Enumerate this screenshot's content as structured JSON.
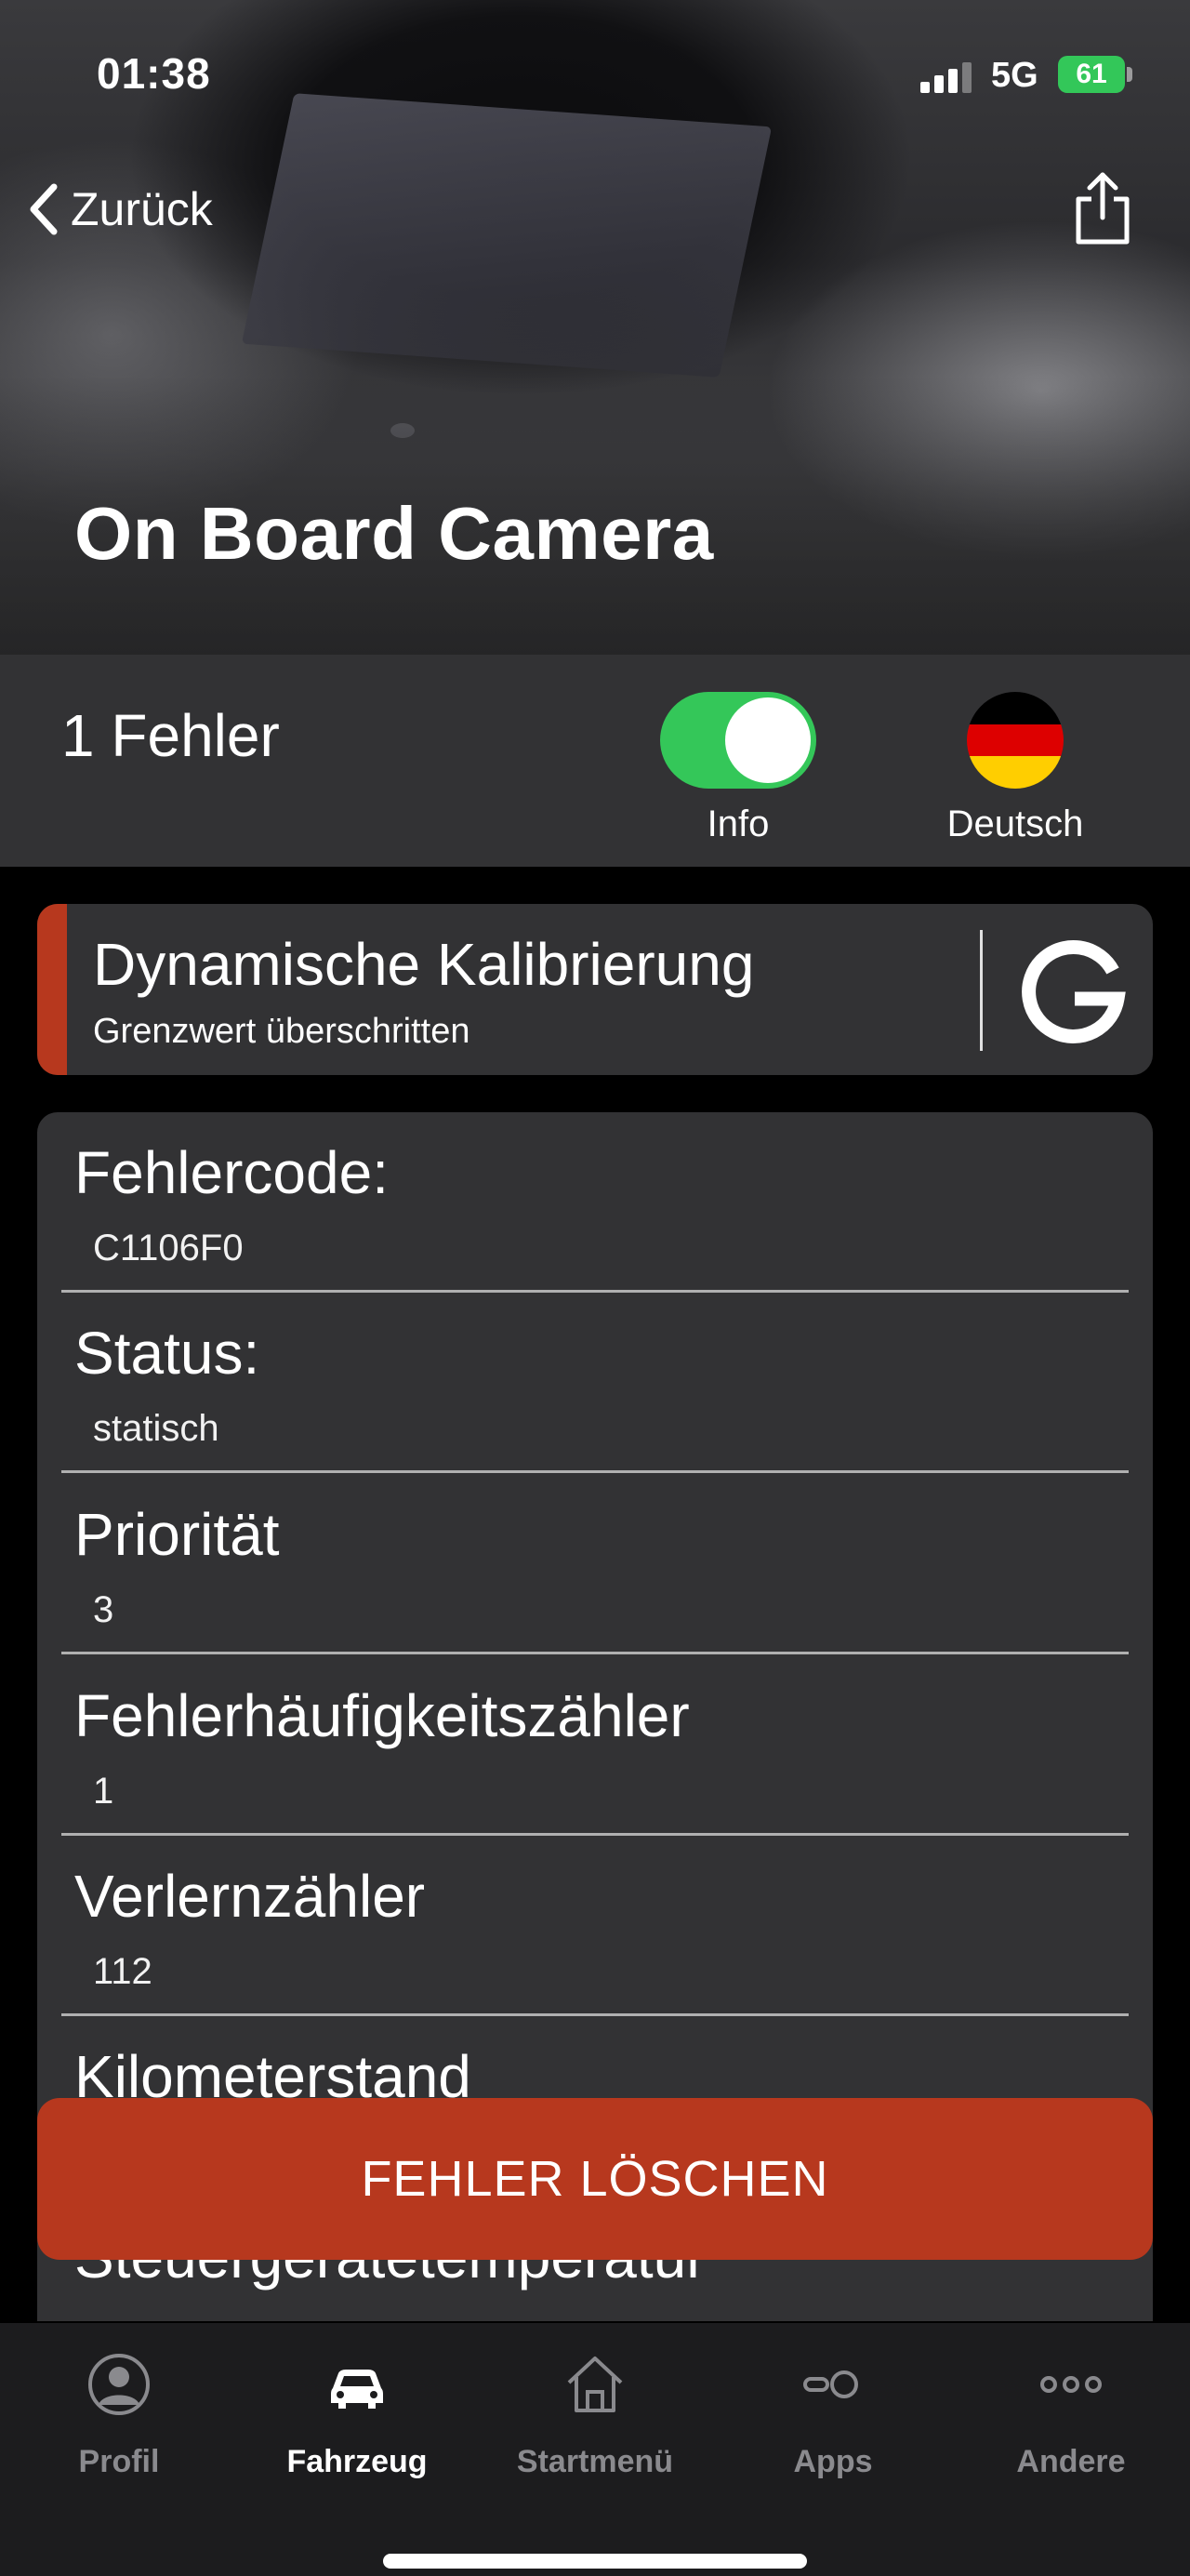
{
  "status_bar": {
    "time": "01:38",
    "network": "5G",
    "battery": "61"
  },
  "header": {
    "back_label": "Zurück",
    "title": "On Board Camera"
  },
  "summary": {
    "fault_count": "1 Fehler",
    "toggle_label": "Info",
    "toggle_on": true,
    "language_label": "Deutsch"
  },
  "error": {
    "title": "Dynamische Kalibrierung",
    "subtitle": "Grenzwert überschritten",
    "google_letter": "G"
  },
  "details": [
    {
      "label": "Fehlercode:",
      "value": "C1106F0"
    },
    {
      "label": "Status:",
      "value": "statisch"
    },
    {
      "label": "Priorität",
      "value": "3"
    },
    {
      "label": "Fehlerhäufigkeitszähler",
      "value": "1"
    },
    {
      "label": "Verlernzähler",
      "value": "112"
    },
    {
      "label": "Kilometerstand",
      "value": ""
    },
    {
      "label": "Steuergerätetemperatur",
      "value": ""
    }
  ],
  "clear_button": "FEHLER LÖSCHEN",
  "tabbar": [
    {
      "label": "Profil",
      "icon": "profile-icon"
    },
    {
      "label": "Fahrzeug",
      "icon": "car-icon"
    },
    {
      "label": "Startmenü",
      "icon": "home-icon"
    },
    {
      "label": "Apps",
      "icon": "apps-icon"
    },
    {
      "label": "Andere",
      "icon": "more-icon"
    }
  ],
  "colors": {
    "accent_red": "#b7381e",
    "toggle_green": "#34c759",
    "card_bg": "#323234",
    "tabbar_bg": "#1c1c1e"
  }
}
